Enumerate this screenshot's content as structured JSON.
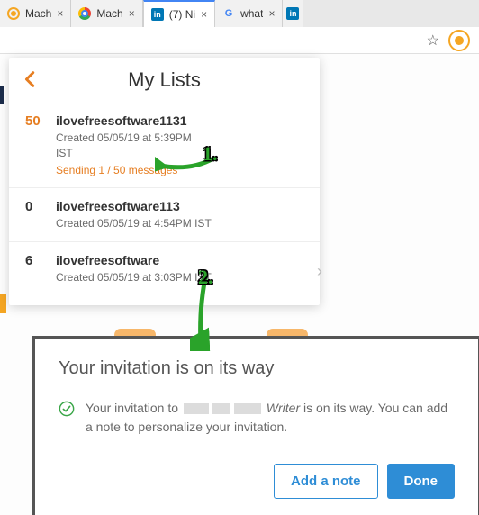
{
  "tabs": [
    {
      "label": "Mach",
      "icon": "orange"
    },
    {
      "label": "Mach",
      "icon": "chrome"
    },
    {
      "label": "(7) Ni",
      "icon": "in",
      "active": true
    },
    {
      "label": "what",
      "icon": "g"
    },
    {
      "label": "",
      "icon": "in"
    }
  ],
  "panel": {
    "title": "My Lists",
    "rows": [
      {
        "count": "50",
        "count_orange": true,
        "name": "ilovefreesoftware1131",
        "meta1": "Created 05/05/19 at 5:39PM",
        "meta2": "IST",
        "sending": "Sending 1 / 50 messages"
      },
      {
        "count": "0",
        "name": "ilovefreesoftware113",
        "meta1": "Created 05/05/19 at 4:54PM IST"
      },
      {
        "count": "6",
        "name": "ilovefreesoftware",
        "meta1": "Created 05/05/19 at 3:03PM IST"
      }
    ]
  },
  "card": {
    "title": "Your invitation is on its way",
    "line_prefix": "Your invitation to",
    "line_italic": "Writer",
    "line_suffix": "is on its way. You can add a note to personalize your invitation.",
    "add_note": "Add a note",
    "done": "Done"
  },
  "annotations": {
    "one": "1.",
    "two": "2."
  }
}
